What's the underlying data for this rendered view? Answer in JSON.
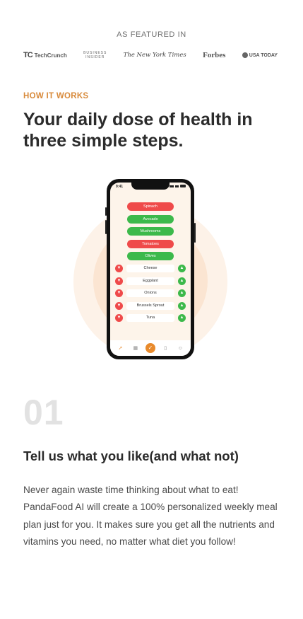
{
  "featured": {
    "label": "AS FEATURED IN",
    "logos": [
      {
        "mark": "TC",
        "name": "TechCrunch"
      },
      {
        "line1": "BUSINESS",
        "line2": "INSIDER"
      },
      {
        "name": "The New York Times"
      },
      {
        "name": "Forbes"
      },
      {
        "name": "USA TODAY"
      }
    ]
  },
  "how": {
    "eyebrow": "HOW IT WORKS",
    "headline": "Your daily dose of health in three simple steps."
  },
  "phone": {
    "time": "9:41",
    "pills": [
      {
        "label": "Spinach",
        "color": "#ef4a4a"
      },
      {
        "label": "Avocado",
        "color": "#3cb94b"
      },
      {
        "label": "Mushrooms",
        "color": "#3cb94b"
      },
      {
        "label": "Tomatoes",
        "color": "#ef4a4a"
      },
      {
        "label": "Olives",
        "color": "#3cb94b"
      }
    ],
    "foods": [
      "Cheese",
      "Eggplant",
      "Onions",
      "Brussels Sprout",
      "Tuna"
    ],
    "icons": {
      "dislike": "thumbs-down-icon",
      "like": "thumbs-up-icon",
      "tabs": [
        "carrot-icon",
        "calendar-icon",
        "check-icon",
        "bookmark-icon",
        "profile-icon"
      ]
    },
    "accent": "#e88a2c"
  },
  "step": {
    "number": "01",
    "title": "Tell us what you like(and what not)",
    "body": "Never again waste time thinking about what to eat! PandaFood AI will create a 100% personalized weekly meal plan just for you. It makes sure you get all the nutrients and vitamins you need, no matter what diet you follow!"
  }
}
